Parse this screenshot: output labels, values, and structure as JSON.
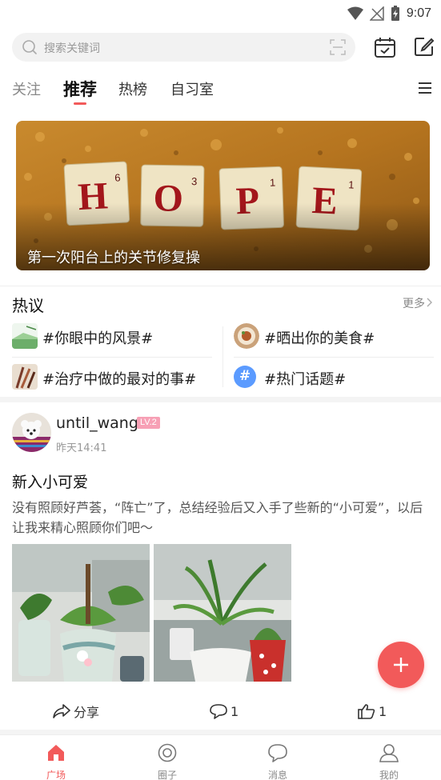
{
  "status_bar": {
    "time": "9:07"
  },
  "search": {
    "placeholder": "搜索关键词"
  },
  "tabs": [
    {
      "label": "关注"
    },
    {
      "label": "推荐"
    },
    {
      "label": "热榜"
    },
    {
      "label": "自习室"
    }
  ],
  "banner": {
    "caption": "第一次阳台上的关节修复操",
    "tiles": [
      "H",
      "O",
      "P",
      "E"
    ],
    "tile_scores": [
      "6",
      "3",
      "1",
      "1"
    ]
  },
  "hot": {
    "title": "热议",
    "more": "更多",
    "topics": [
      {
        "label": "#你眼中的风景#"
      },
      {
        "label": "#晒出你的美食#"
      },
      {
        "label": "#治疗中做的最对的事#"
      },
      {
        "label": "#热门话题#",
        "icon_glyph": "#"
      }
    ]
  },
  "post": {
    "username": "until_wang",
    "level": "LV.2",
    "time": "昨天14:41",
    "title": "新入小可爱",
    "body": "没有照顾好芦荟，“阵亡”了，总结经验后又入手了些新的“小可爱”，以后让我来精心照顾你们吧～",
    "actions": {
      "share": "分享",
      "comments": "1",
      "likes": "1"
    }
  },
  "bottom_nav": [
    {
      "label": "广场",
      "active": true
    },
    {
      "label": "圈子"
    },
    {
      "label": "消息"
    },
    {
      "label": "我的"
    }
  ],
  "colors": {
    "accent": "#f25a5a",
    "badge": "#f7a0b5"
  }
}
